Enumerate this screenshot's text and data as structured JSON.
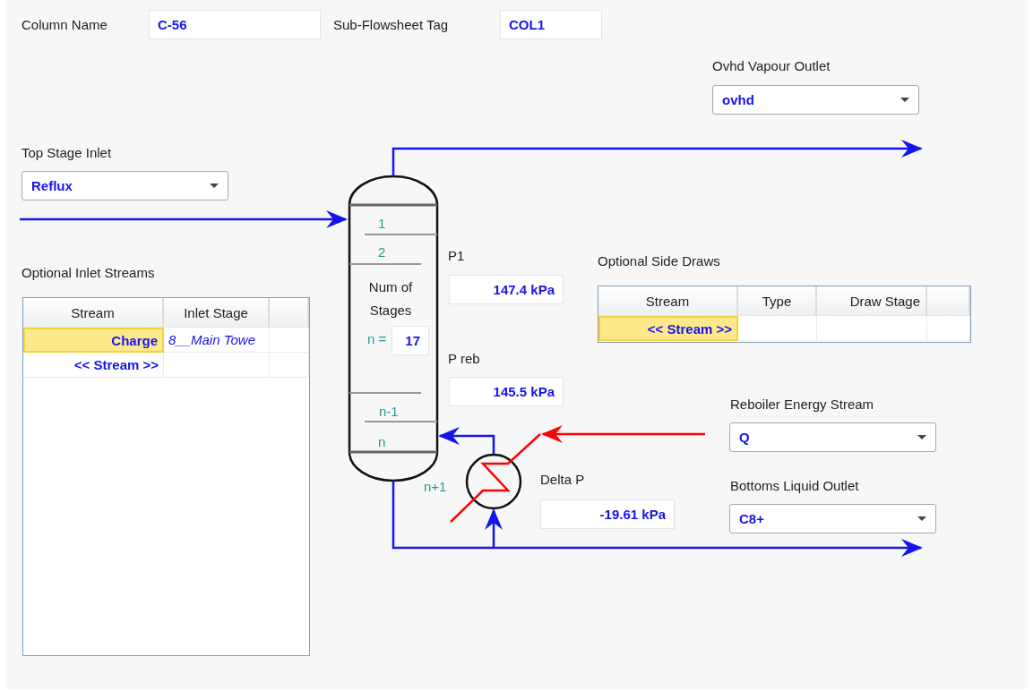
{
  "column_name": {
    "label": "Column Name",
    "value": "C-56"
  },
  "subflowsheet_tag": {
    "label": "Sub-Flowsheet Tag",
    "value": "COL1"
  },
  "ovhd_vapour_outlet": {
    "label": "Ovhd Vapour Outlet",
    "value": "ovhd"
  },
  "top_stage_inlet": {
    "label": "Top Stage Inlet",
    "value": "Reflux"
  },
  "optional_inlet_streams": {
    "label": "Optional Inlet Streams",
    "columns": [
      "Stream",
      "Inlet Stage"
    ],
    "rows": [
      {
        "stream": "Charge",
        "inlet_stage": "8__Main Towe",
        "selected": true
      },
      {
        "stream": "<< Stream >>",
        "selected": false
      }
    ]
  },
  "column": {
    "stage_labels": [
      "1",
      "2",
      "n-1",
      "n",
      "n+1"
    ],
    "num_stages_label": "Num of Stages",
    "n_label": "n =",
    "num_stages": "17"
  },
  "p1": {
    "label": "P1",
    "value": "147.4 kPa"
  },
  "p_reb": {
    "label": "P reb",
    "value": "145.5 kPa"
  },
  "delta_p": {
    "label": "Delta P",
    "value": "-19.61 kPa"
  },
  "optional_side_draws": {
    "label": "Optional Side Draws",
    "columns": [
      "Stream",
      "Type",
      "Draw Stage"
    ],
    "rows": [
      {
        "stream": "<< Stream >>",
        "selected": true
      }
    ]
  },
  "reboiler_energy_stream": {
    "label": "Reboiler Energy Stream",
    "value": "Q"
  },
  "bottoms_liquid_outlet": {
    "label": "Bottoms Liquid Outlet",
    "value": "C8+"
  }
}
